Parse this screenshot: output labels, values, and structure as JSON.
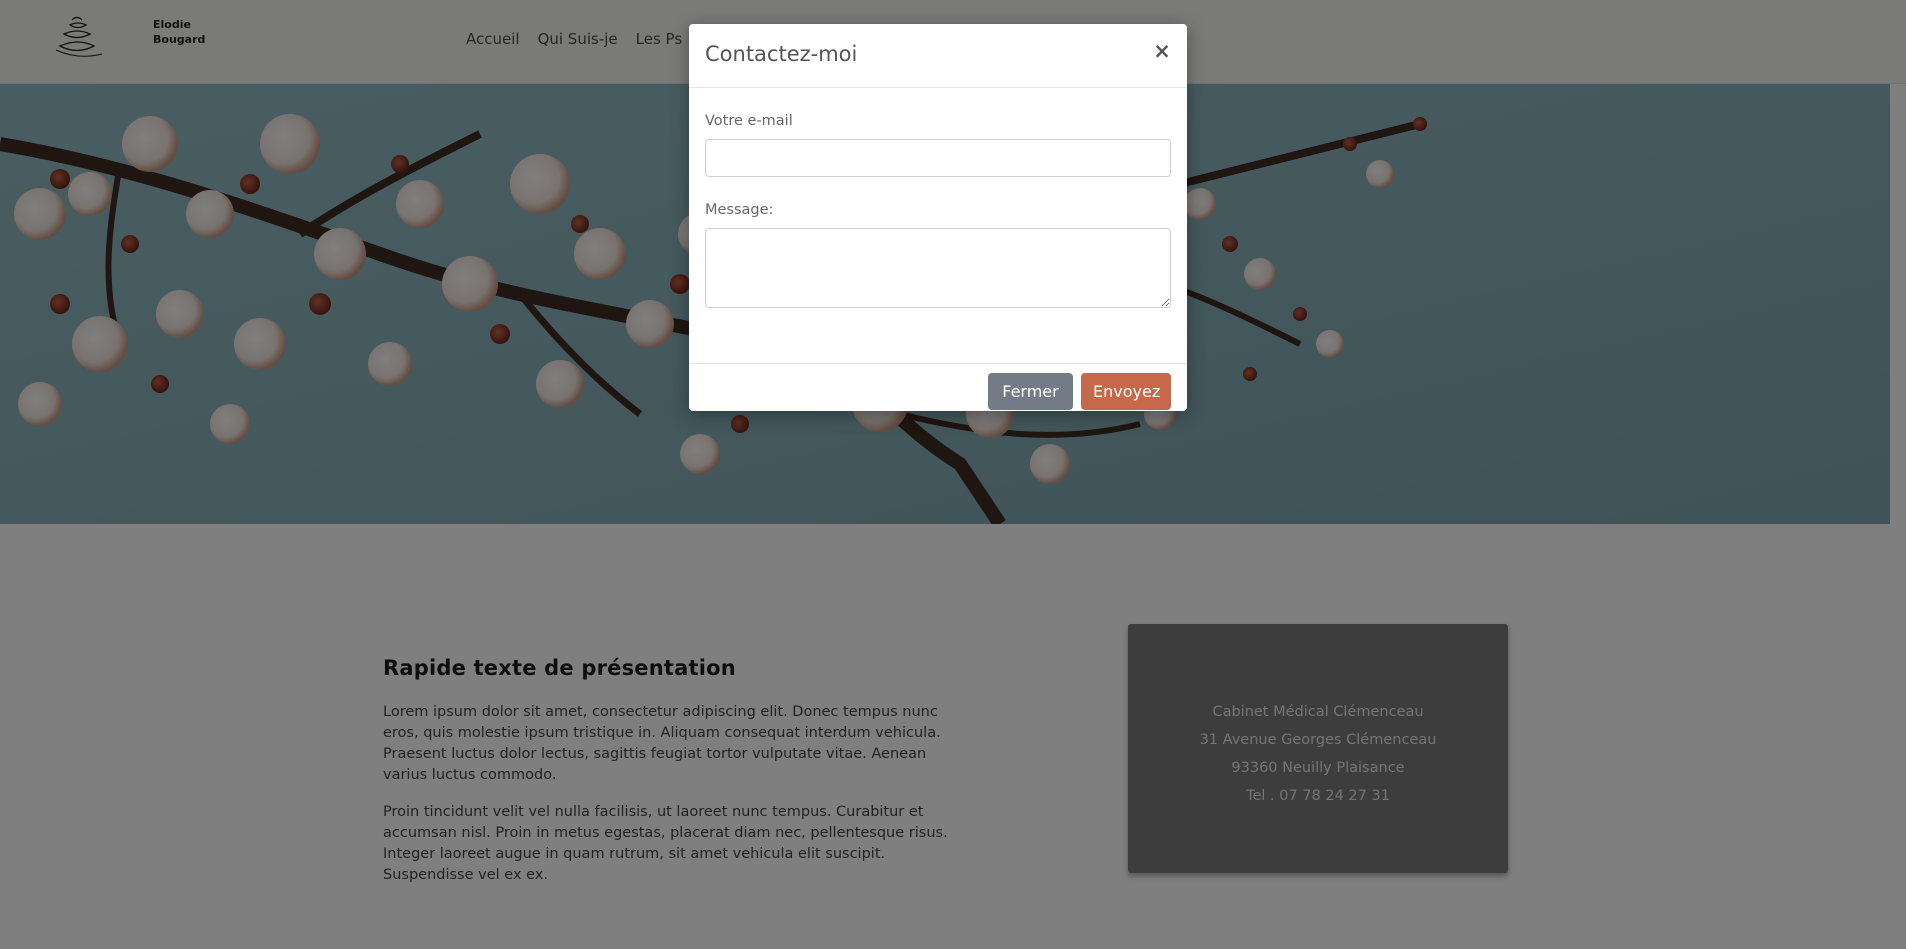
{
  "brand": {
    "line1": "Elodie",
    "line2": "Bougard"
  },
  "nav": {
    "items": [
      "Accueil",
      "Qui Suis-je",
      "Les Ps"
    ]
  },
  "content": {
    "title": "Rapide texte de présentation",
    "paragraphs": [
      "Lorem ipsum dolor sit amet, consectetur adipiscing elit. Donec tempus nunc eros, quis molestie ipsum tristique in. Aliquam consequat interdum vehicula. Praesent luctus dolor lectus, sagittis feugiat tortor vulputate vitae. Aenean varius luctus commodo.",
      "Proin tincidunt velit vel nulla facilisis, ut laoreet nunc tempus. Curabitur et accumsan nisl. Proin in metus egestas, placerat diam nec, pellentesque risus. Integer laoreet augue in quam rutrum, sit amet vehicula elit suscipit. Suspendisse vel ex ex."
    ]
  },
  "card": {
    "lines": [
      "Cabinet Médical Clémenceau",
      "31 Avenue Georges Clémenceau",
      "93360 Neuilly Plaisance",
      "Tel . 07 78 24 27 31"
    ]
  },
  "modal": {
    "title": "Contactez-moi",
    "close_symbol": "×",
    "email_label": "Votre e-mail",
    "email_value": "",
    "message_label": "Message:",
    "message_value": "",
    "close_button": "Fermer",
    "send_button": "Envoyez"
  },
  "colors": {
    "send_button": "#c8684a",
    "close_button": "#737b86",
    "card_bg": "#7b7b7b"
  }
}
